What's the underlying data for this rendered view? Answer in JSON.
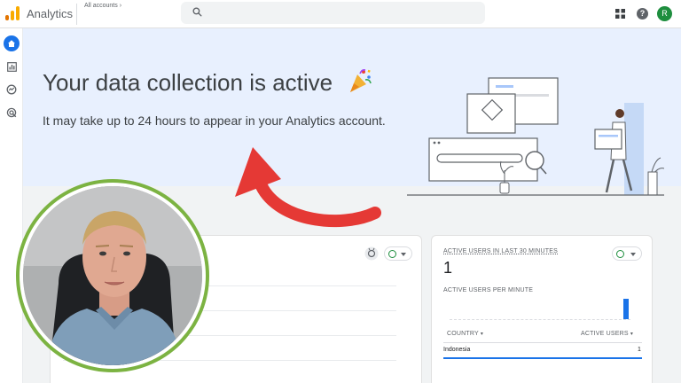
{
  "topbar": {
    "app_title": "Analytics",
    "accounts_label": "All accounts",
    "accounts_chevron": "›",
    "help_glyph": "?",
    "avatar_initial": "R"
  },
  "sidebar": {
    "items": [
      {
        "icon": "home-icon",
        "active": true
      },
      {
        "icon": "reports-icon",
        "active": false
      },
      {
        "icon": "explore-icon",
        "active": false
      },
      {
        "icon": "advertising-icon",
        "active": false
      }
    ]
  },
  "banner": {
    "title": "Your data collection is active",
    "subtitle": "It may take up to 24 hours to appear in your Analytics account."
  },
  "realtime_card": {
    "active_users_label": "ACTIVE USERS IN LAST 30 MINUTES",
    "active_users_value": "1",
    "per_minute_label": "ACTIVE USERS PER MINUTE",
    "country_header": "COUNTRY",
    "active_users_header": "ACTIVE USERS",
    "rows": [
      {
        "country": "Indonesia",
        "users": "1"
      }
    ]
  },
  "colors": {
    "accent": "#1a73e8",
    "success": "#1e8e3e",
    "banner_bg": "#e8f0fe",
    "arrow": "#e53935",
    "ring": "#7cb342"
  }
}
